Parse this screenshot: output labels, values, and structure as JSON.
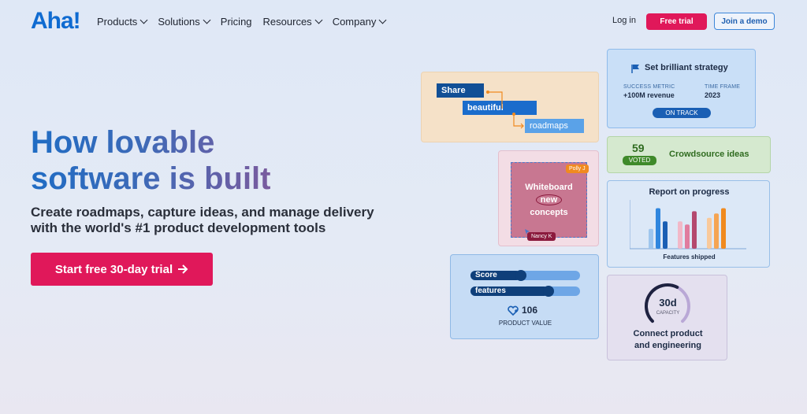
{
  "nav": {
    "logo": "Aha!",
    "items": [
      {
        "label": "Products",
        "has_dropdown": true
      },
      {
        "label": "Solutions",
        "has_dropdown": true
      },
      {
        "label": "Pricing",
        "has_dropdown": false
      },
      {
        "label": "Resources",
        "has_dropdown": true
      },
      {
        "label": "Company",
        "has_dropdown": true
      }
    ],
    "login": "Log in",
    "free_trial": "Free trial",
    "join_demo": "Join a demo"
  },
  "hero": {
    "title_line1": "How lovable",
    "title_line2": "software is built",
    "subtitle_line1": "Create roadmaps, capture ideas, and manage delivery",
    "subtitle_line2": "with the world's #1 product development tools",
    "cta": "Start free 30-day trial",
    "cta_icon": "arrow-right-icon"
  },
  "cards": {
    "share": {
      "w1": "Share",
      "w2": "beautiful",
      "w3": "roadmaps"
    },
    "strategy": {
      "icon": "flag-icon",
      "title": "Set brilliant strategy",
      "metric_label": "SUCCESS METRIC",
      "metric_value": "+100M revenue",
      "time_label": "TIME FRAME",
      "time_value": "2023",
      "status": "ON TRACK"
    },
    "crowd": {
      "count": "59",
      "voted": "VOTED",
      "title": "Crowdsource ideas"
    },
    "whiteboard": {
      "l1": "Whiteboard",
      "l2": "new",
      "l3": "concepts",
      "cursor1": "Polly J",
      "cursor2": "Nancy K"
    },
    "report": {
      "title": "Report on progress",
      "caption": "Features shipped",
      "groups": [
        [
          0.45,
          0.92,
          0.62
        ],
        [
          0.62,
          0.55,
          0.85
        ],
        [
          0.7,
          0.8,
          0.92
        ]
      ],
      "colors": [
        [
          "#9fc6ee",
          "#2f86de",
          "#1a5fb4"
        ],
        [
          "#f2b8c8",
          "#e07c9e",
          "#b4486e"
        ],
        [
          "#f9c99b",
          "#f5a452",
          "#f08a1f"
        ]
      ]
    },
    "score": {
      "s1": "Score",
      "s2": "features",
      "s1_fill": 0.46,
      "s2_fill": 0.71,
      "value": "106",
      "label": "PRODUCT VALUE",
      "icon": "heart-plus-icon"
    },
    "connect": {
      "days": "30d",
      "capacity": "CAPACITY",
      "l1": "Connect product",
      "l2": "and engineering",
      "capacity_fill": 0.6
    }
  },
  "colors": {
    "accent": "#e0185a",
    "brand": "#0f6bd1"
  }
}
